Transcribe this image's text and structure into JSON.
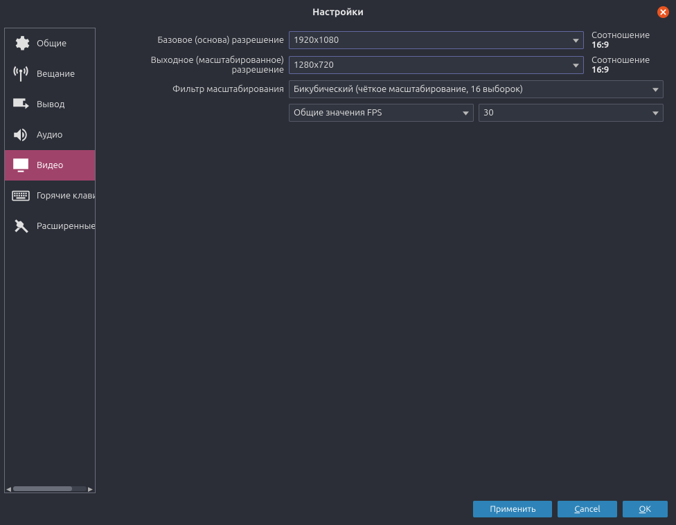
{
  "window": {
    "title": "Настройки"
  },
  "sidebar": {
    "items": [
      {
        "label": "Общие"
      },
      {
        "label": "Вещание"
      },
      {
        "label": "Вывод"
      },
      {
        "label": "Аудио"
      },
      {
        "label": "Видео"
      },
      {
        "label": "Горячие клавиши"
      },
      {
        "label": "Расширенные"
      }
    ]
  },
  "form": {
    "base_res": {
      "label": "Базовое (основа) разрешение",
      "value": "1920x1080",
      "ratio_label": "Соотношение",
      "ratio_value": "16:9"
    },
    "output_res": {
      "label": "Выходное (масштабированное) разрешение",
      "value": "1280x720",
      "ratio_label": "Соотношение",
      "ratio_value": "16:9"
    },
    "scale_filter": {
      "label": "Фильтр масштабирования",
      "value": "Бикубический (чёткое масштабирование, 16 выборок)"
    },
    "fps": {
      "type_label": "Общие значения FPS",
      "value": "30"
    }
  },
  "buttons": {
    "apply": "Применить",
    "cancel": "Cancel",
    "ok": "OK"
  }
}
